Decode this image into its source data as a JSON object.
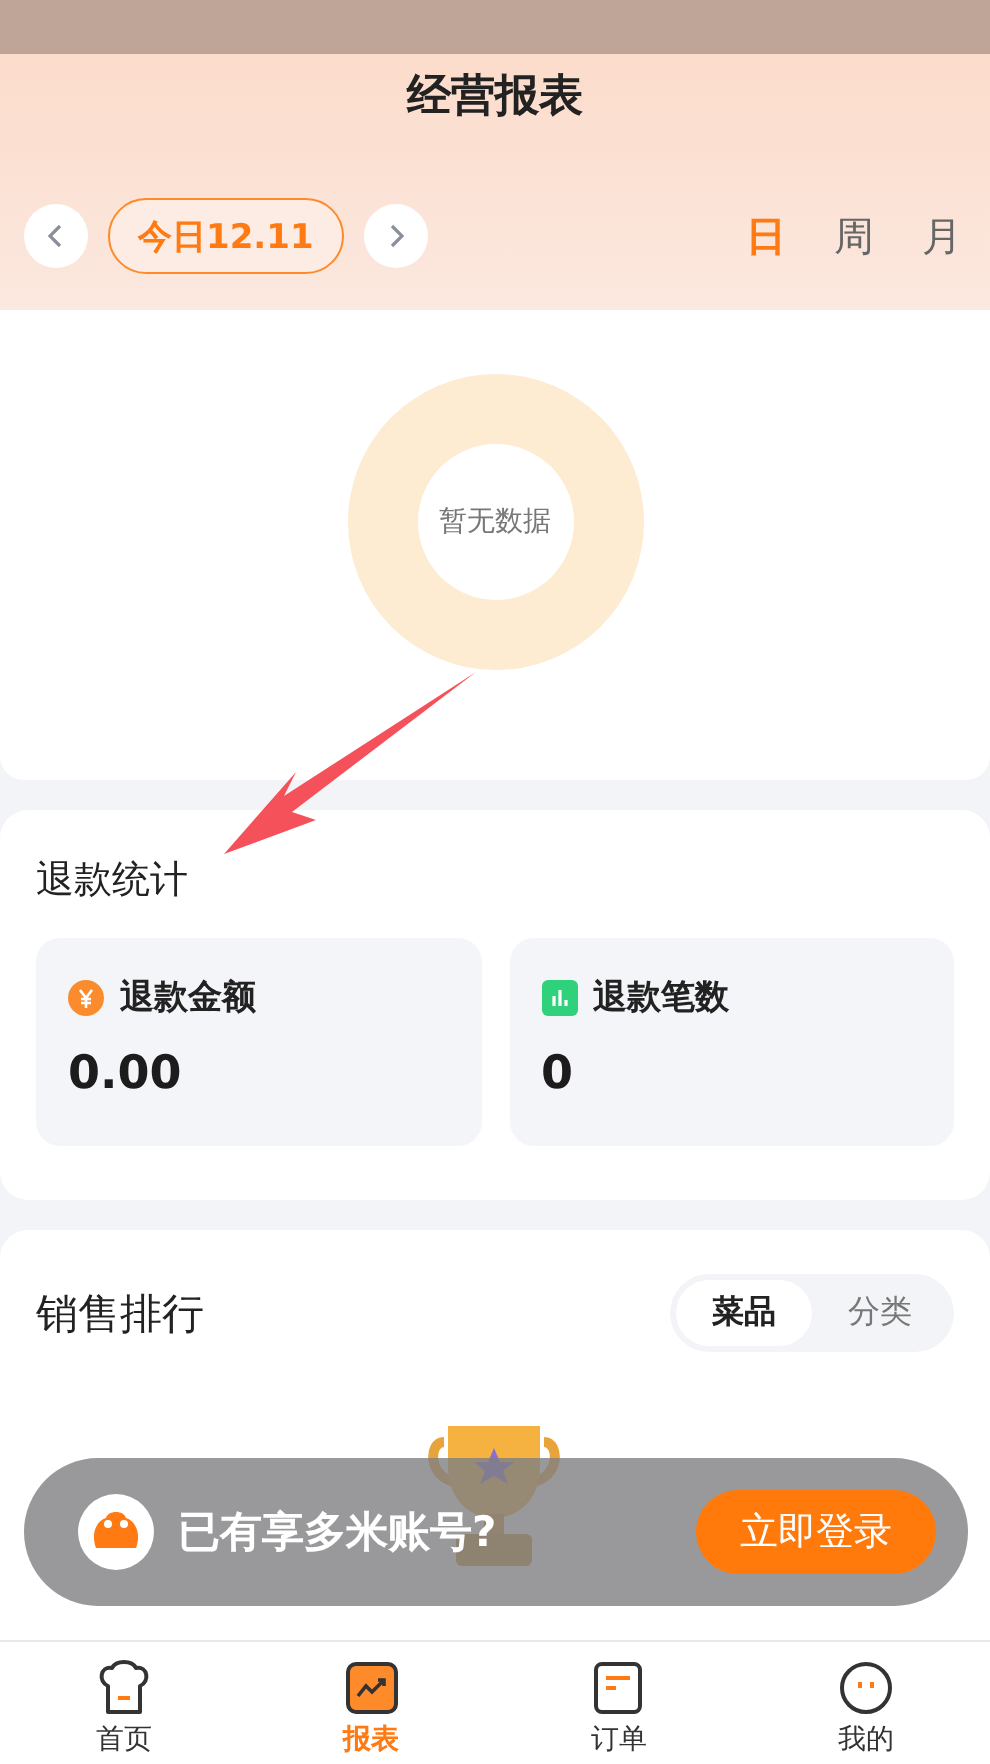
{
  "header": {
    "title": "经营报表"
  },
  "date_nav": {
    "label": "今日12.11"
  },
  "period_tabs": [
    {
      "label": "日",
      "selected": true
    },
    {
      "label": "周",
      "selected": false
    },
    {
      "label": "月",
      "selected": false
    }
  ],
  "chart": {
    "empty_text": "暂无数据"
  },
  "refund": {
    "title": "退款统计",
    "cards": [
      {
        "kind": "amount",
        "label": "退款金额",
        "value": "0.00"
      },
      {
        "kind": "count",
        "label": "退款笔数",
        "value": "0"
      }
    ]
  },
  "sales": {
    "title": "销售排行",
    "segments": [
      {
        "label": "菜品",
        "selected": true
      },
      {
        "label": "分类",
        "selected": false
      }
    ]
  },
  "login_banner": {
    "text": "已有享多米账号?",
    "button": "立即登录"
  },
  "tab_bar": [
    {
      "kind": "home",
      "label": "首页",
      "selected": false
    },
    {
      "kind": "report",
      "label": "报表",
      "selected": true
    },
    {
      "kind": "orders",
      "label": "订单",
      "selected": false
    },
    {
      "kind": "mine",
      "label": "我的",
      "selected": false
    }
  ]
}
